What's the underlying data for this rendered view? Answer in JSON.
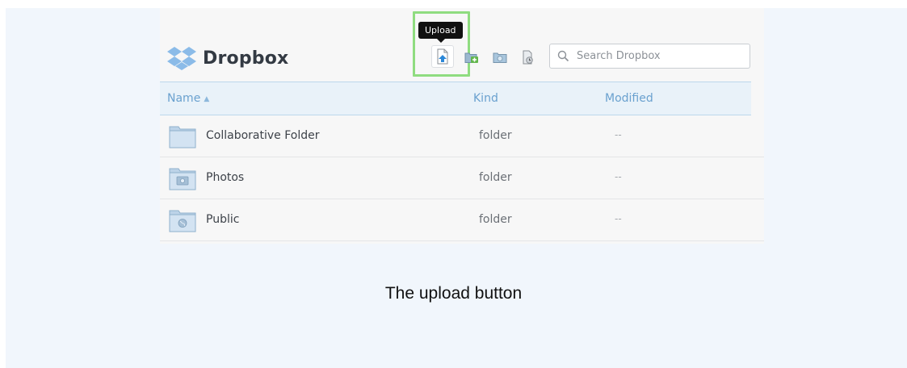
{
  "app": {
    "name": "Dropbox"
  },
  "toolbar": {
    "tooltip": "Upload",
    "tools": [
      {
        "icon": "upload-icon"
      },
      {
        "icon": "new-shared-folder-icon"
      },
      {
        "icon": "new-folder-icon"
      },
      {
        "icon": "show-deleted-files-icon"
      }
    ]
  },
  "search": {
    "placeholder": "Search Dropbox"
  },
  "table": {
    "columns": {
      "name": "Name",
      "kind": "Kind",
      "modified": "Modified",
      "sort_indicator": "▲"
    },
    "rows": [
      {
        "name": "Collaborative Folder",
        "kind": "folder",
        "modified": "--",
        "icon": "folder-icon"
      },
      {
        "name": "Photos",
        "kind": "folder",
        "modified": "--",
        "icon": "photos-folder-icon"
      },
      {
        "name": "Public",
        "kind": "folder",
        "modified": "--",
        "icon": "public-folder-icon"
      }
    ]
  },
  "caption": "The upload button",
  "colors": {
    "frame_background": "#f1f6fc",
    "highlight": "#8fdc80",
    "header_text": "#6aa1cf",
    "dropbox_blue": "#7fb3e6"
  }
}
